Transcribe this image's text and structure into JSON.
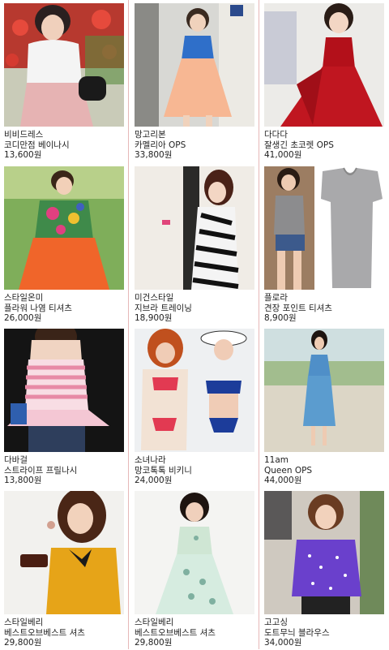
{
  "products": [
    {
      "shop": "비비드레스",
      "name": "코디만점 베이나시",
      "price": "13,600원",
      "image": "woman-white-top-pink-skirt-flowers"
    },
    {
      "shop": "망고리본",
      "name": "카멜리아 OPS",
      "price": "33,800원",
      "image": "woman-blue-peach-dress"
    },
    {
      "shop": "다다다",
      "name": "잘생긴 초코렛 OPS",
      "price": "41,000원",
      "image": "woman-red-chiffon-dress"
    },
    {
      "shop": "스타일온미",
      "name": "플라워 나염 티셔츠",
      "price": "26,000원",
      "image": "woman-floral-top-orange-skirt"
    },
    {
      "shop": "미건스타일",
      "name": "지브라 트레이닝",
      "price": "18,900원",
      "image": "woman-zebra-print-dress"
    },
    {
      "shop": "플로라",
      "name": "견장 포인트 티셔츠",
      "price": "8,900원",
      "image": "gray-tshirt-and-model"
    },
    {
      "shop": "다바걸",
      "name": "스트라이프 프릴나시",
      "price": "13,800원",
      "image": "woman-pink-stripe-top"
    },
    {
      "shop": "소녀나라",
      "name": "망코톡톡 비키니",
      "price": "24,000원",
      "image": "women-bikini"
    },
    {
      "shop": "11am",
      "name": "Queen OPS",
      "price": "44,000원",
      "image": "woman-blue-maxi-dress-park"
    },
    {
      "shop": "스타일베리",
      "name": "베스트오브베스트 셔츠",
      "price": "29,800원",
      "image": "woman-mustard-blouse"
    },
    {
      "shop": "스타일베리",
      "name": "베스트오브베스트 셔츠",
      "price": "29,800원",
      "image": "woman-mint-floral-dress"
    },
    {
      "shop": "고고싱",
      "name": "도트무늬 블라우스",
      "price": "34,000원",
      "image": "woman-purple-dot-blouse"
    }
  ],
  "colors": {
    "divider": "#e6b8b8",
    "text": "#222222"
  }
}
